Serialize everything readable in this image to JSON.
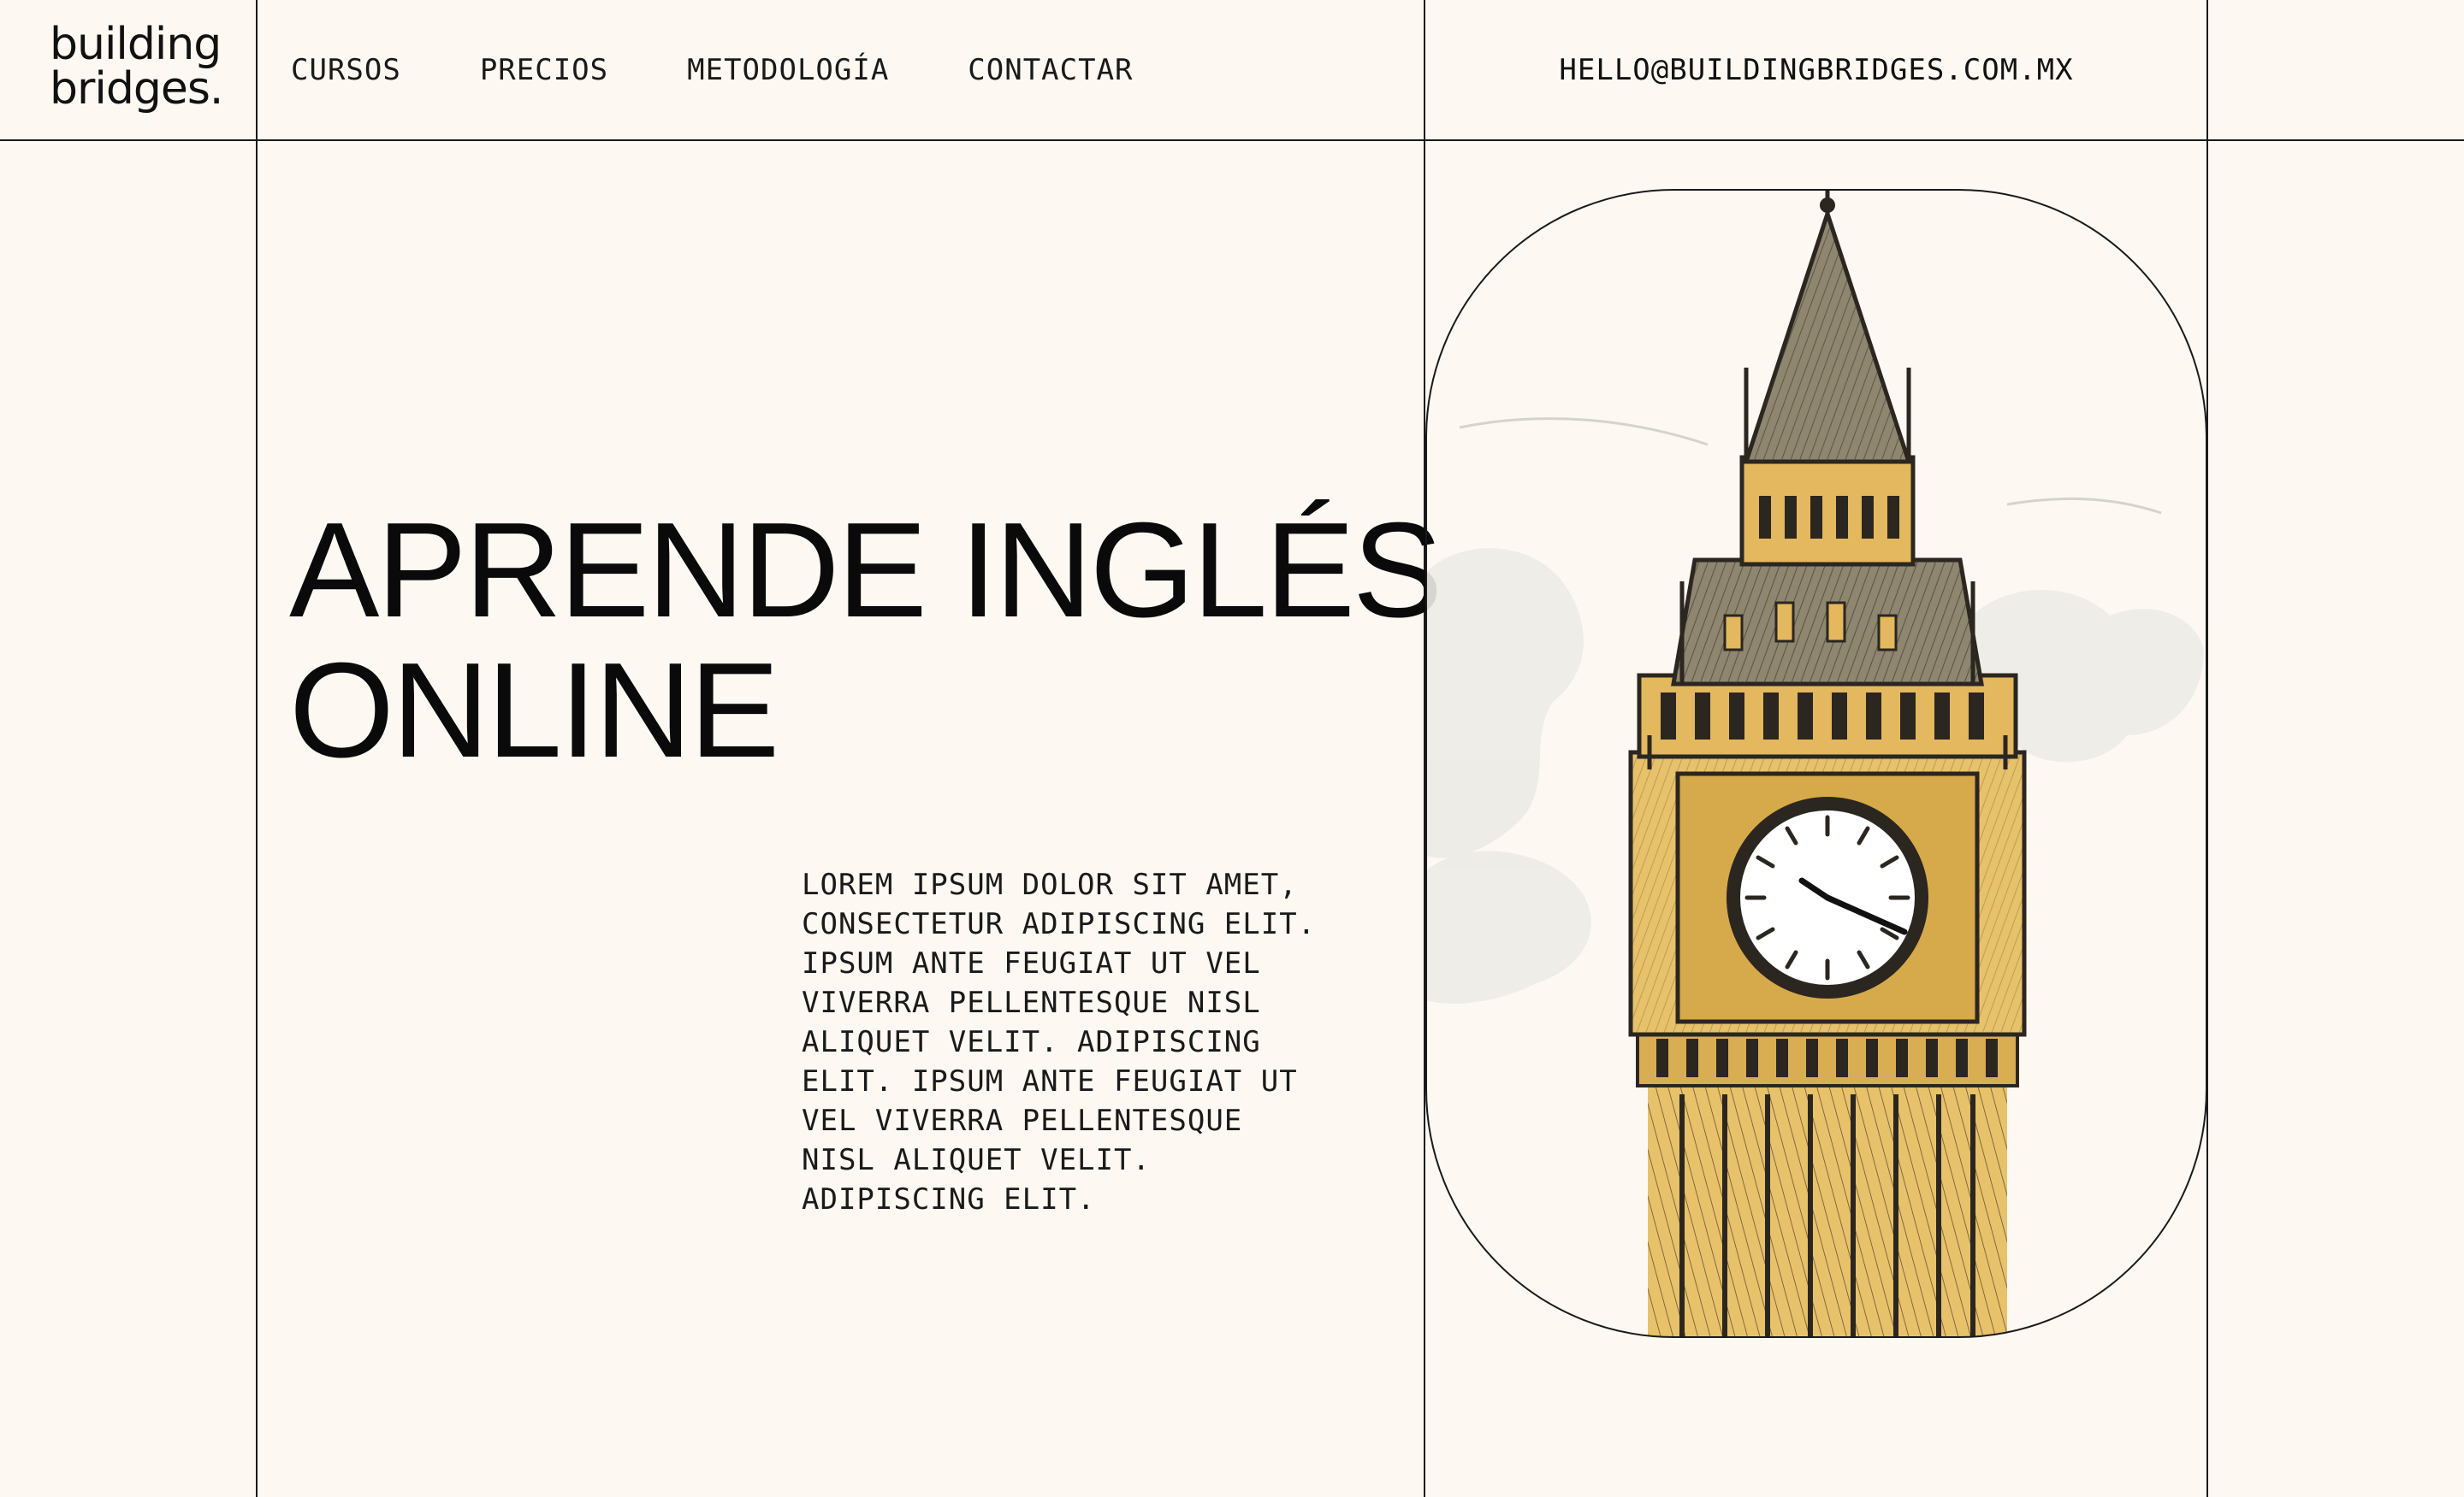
{
  "brand": {
    "logo_line1": "building",
    "logo_line2": "bridges."
  },
  "nav": {
    "items": [
      {
        "label": "CURSOS"
      },
      {
        "label": "PRECIOS"
      },
      {
        "label": "METODOLOGÍA"
      },
      {
        "label": "CONTACTAR"
      }
    ],
    "email": "HELLO@BUILDINGBRIDGES.COM.MX"
  },
  "hero": {
    "title_line1": "APRENDE INGLÉS",
    "title_line2": "ONLINE",
    "body": "LOREM IPSUM DOLOR SIT AMET,\nCONSECTETUR ADIPISCING ELIT.\nIPSUM ANTE FEUGIAT UT VEL\nVIVERRA PELLENTESQUE NISL\nALIQUET VELIT. ADIPISCING\nELIT. IPSUM ANTE FEUGIAT UT\nVEL VIVERRA PELLENTESQUE\nNISL ALIQUET VELIT.\nADIPISCING ELIT."
  },
  "illustration": {
    "subject": "big-ben-clock-tower-sketch"
  },
  "colors": {
    "background": "#fdf9f2",
    "ink": "#111111",
    "tower_gold": "#e8c26a",
    "tower_shadow": "#8a7a5a",
    "roof": "#8f8670",
    "clock_face": "#ffffff",
    "cloud": "#ecebe6"
  }
}
